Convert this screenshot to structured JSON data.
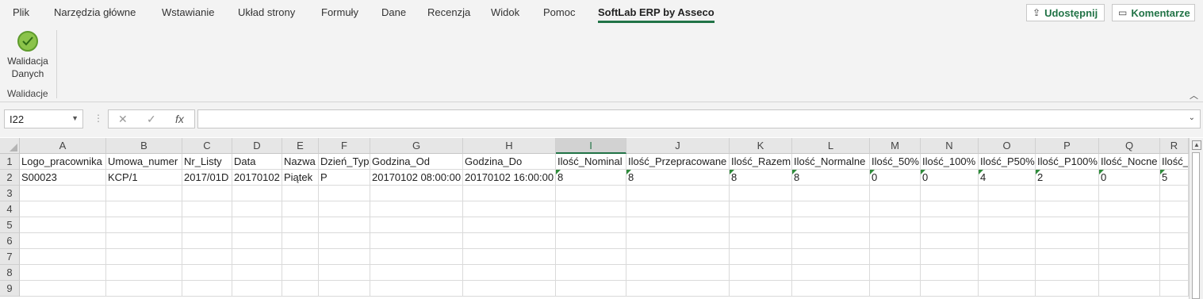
{
  "ribbon_tabs": [
    "Plik",
    "Narzędzia główne",
    "Wstawianie",
    "Układ strony",
    "Formuły",
    "Dane",
    "Recenzja",
    "Widok",
    "Pomoc",
    "SoftLab ERP by Asseco"
  ],
  "active_tab": "SoftLab ERP by Asseco",
  "share_label": "Udostępnij",
  "comments_label": "Komentarze",
  "ribbon": {
    "validate_label_1": "Walidacja",
    "validate_label_2": "Danych",
    "group_label": "Walidacje"
  },
  "formula_bar": {
    "name_box": "I22",
    "cancel_icon": "✕",
    "enter_icon": "✓",
    "fx_icon": "fx",
    "formula": ""
  },
  "columns": [
    "A",
    "B",
    "C",
    "D",
    "E",
    "F",
    "G",
    "H",
    "I",
    "J",
    "K",
    "L",
    "M",
    "N",
    "O",
    "P",
    "Q",
    "R"
  ],
  "selected_column": "I",
  "rows": [
    "1",
    "2",
    "3",
    "4",
    "5",
    "6",
    "7",
    "8",
    "9"
  ],
  "header_row": [
    "Logo_pracownika",
    "Umowa_numer",
    "Nr_Listy",
    "Data",
    "Nazwa",
    "Dzień_Typ",
    "Godzina_Od",
    "Godzina_Do",
    "Ilość_Nominal",
    "Ilość_Przepracowane",
    "Ilość_Razem",
    "Ilość_Normalne",
    "Ilość_50%",
    "Ilość_100%",
    "Ilość_P50%",
    "Ilość_P100%",
    "Ilość_Nocne",
    "Ilość_"
  ],
  "data_row": [
    "S00023",
    "KCP/1",
    "2017/01D",
    "20170102",
    "Piątek",
    "P",
    "20170102 08:00:00",
    "20170102 16:00:00",
    "8",
    "8",
    "8",
    "8",
    "0",
    "0",
    "4",
    "2",
    "0",
    "5"
  ],
  "colors": {
    "accent": "#217346",
    "ribbon_bg": "#f3f3f3",
    "header_bg": "#e6e6e6"
  }
}
